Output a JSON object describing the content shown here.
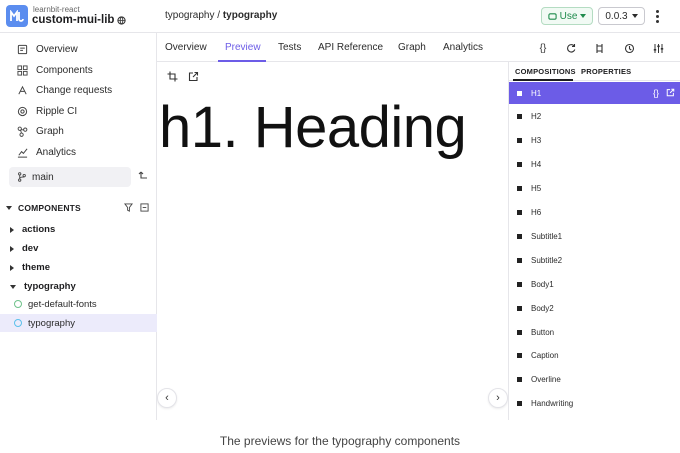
{
  "header": {
    "org": "learnbit-react",
    "scope": "custom-mui-lib",
    "breadcrumb_parent": "typography /",
    "breadcrumb_current": "typography",
    "use_label": "Use",
    "version": "0.0.3"
  },
  "sidebar": {
    "nav": [
      {
        "label": "Overview",
        "icon": "overview-icon"
      },
      {
        "label": "Components",
        "icon": "components-icon"
      },
      {
        "label": "Change requests",
        "icon": "change-requests-icon"
      },
      {
        "label": "Ripple CI",
        "icon": "ripple-ci-icon"
      },
      {
        "label": "Graph",
        "icon": "graph-icon"
      },
      {
        "label": "Analytics",
        "icon": "analytics-icon"
      }
    ],
    "branch": "main",
    "section_title": "COMPONENTS",
    "tree": [
      {
        "label": "actions",
        "expanded": false
      },
      {
        "label": "dev",
        "expanded": false
      },
      {
        "label": "theme",
        "expanded": false
      },
      {
        "label": "typography",
        "expanded": true
      }
    ],
    "leaves": [
      {
        "label": "get-default-fonts",
        "selected": false
      },
      {
        "label": "typography",
        "selected": true
      }
    ]
  },
  "tabs": [
    {
      "label": "Overview",
      "active": false
    },
    {
      "label": "Preview",
      "active": true
    },
    {
      "label": "Tests",
      "active": false
    },
    {
      "label": "API Reference",
      "active": false
    },
    {
      "label": "Graph",
      "active": false
    },
    {
      "label": "Analytics",
      "active": false
    }
  ],
  "toolbar_icons": [
    "code-icon",
    "refresh-icon",
    "compare-icon",
    "history-icon",
    "settings-sliders-icon"
  ],
  "preview": {
    "heading_text": "h1. Heading"
  },
  "panel": {
    "tab_compositions": "COMPOSITIONS",
    "tab_properties": "PROPERTIES",
    "compositions": [
      {
        "label": "H1",
        "selected": true
      },
      {
        "label": "H2",
        "selected": false
      },
      {
        "label": "H3",
        "selected": false
      },
      {
        "label": "H4",
        "selected": false
      },
      {
        "label": "H5",
        "selected": false
      },
      {
        "label": "H6",
        "selected": false
      },
      {
        "label": "Subtitle1",
        "selected": false
      },
      {
        "label": "Subtitle2",
        "selected": false
      },
      {
        "label": "Body1",
        "selected": false
      },
      {
        "label": "Body2",
        "selected": false
      },
      {
        "label": "Button",
        "selected": false
      },
      {
        "label": "Caption",
        "selected": false
      },
      {
        "label": "Overline",
        "selected": false
      },
      {
        "label": "Handwriting",
        "selected": false
      }
    ]
  },
  "caption": "The previews for the typography components",
  "colors": {
    "accent": "#6c5ce7",
    "use_green": "#1f8b4c",
    "logo_blue": "#5b8def"
  }
}
